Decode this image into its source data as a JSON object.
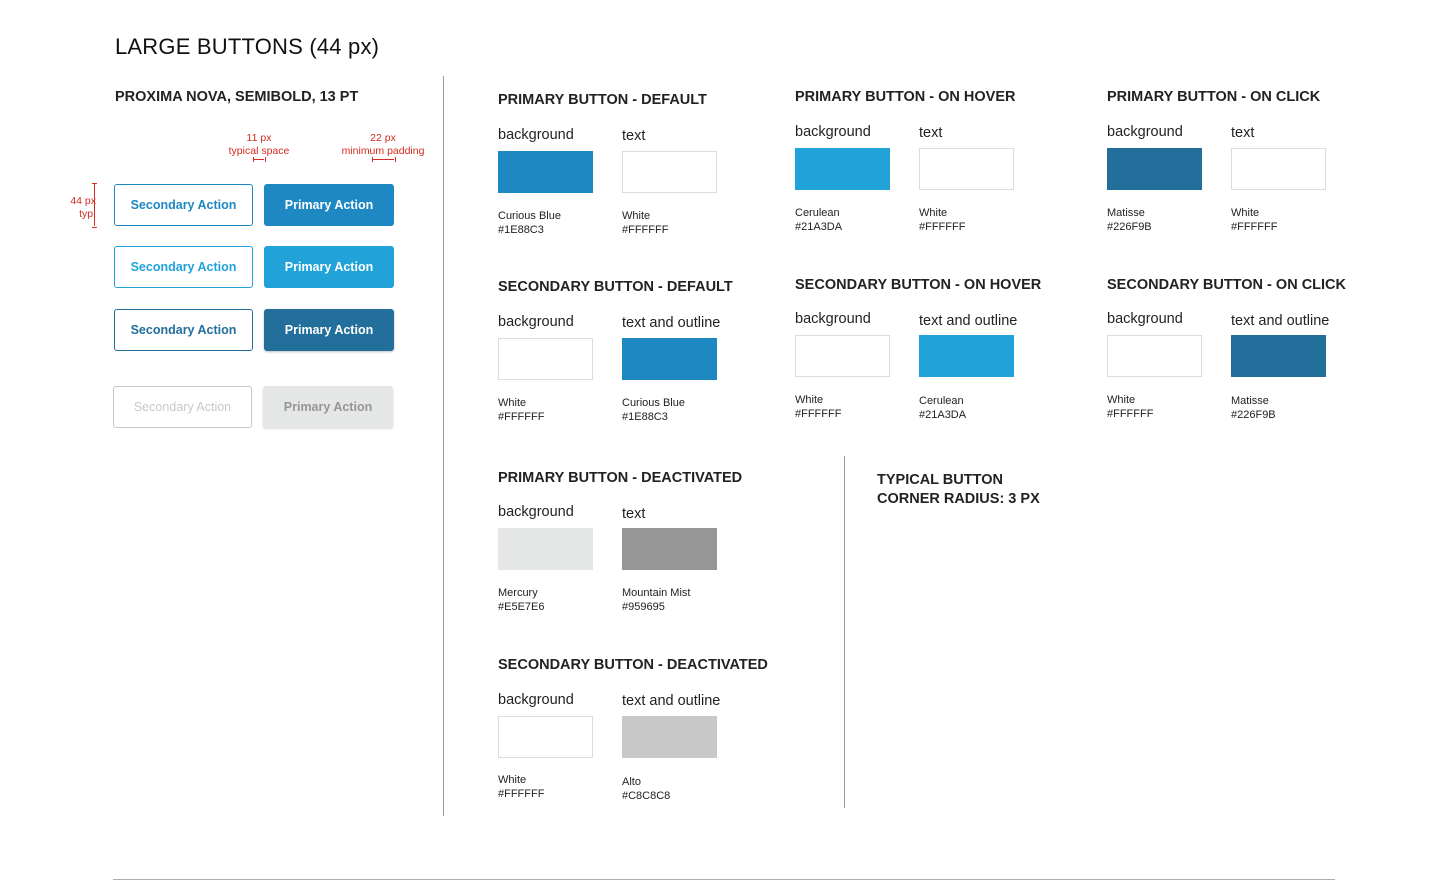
{
  "title": "LARGE BUTTONS (44 px)",
  "font_spec": "PROXIMA NOVA, SEMIBOLD, 13 PT",
  "annotations": {
    "typical_space_value": "11 px",
    "typical_space_label": "typical space",
    "min_padding_value": "22 px",
    "min_padding_label": "minimum padding",
    "height_value": "44 px",
    "height_label": "typ."
  },
  "buttons": {
    "secondary_label": "Secondary Action",
    "primary_label": "Primary Action"
  },
  "colors": {
    "curious_blue": "#1E88C3",
    "cerulean": "#21A3DA",
    "matisse": "#226F9B",
    "mercury": "#E5E7E6",
    "mountain_mist": "#959695",
    "alto": "#C8C8C8",
    "annotation_red": "#D42A20"
  },
  "sections": {
    "primary_default": {
      "title": "PRIMARY BUTTON - DEFAULT",
      "bg_label": "background",
      "bg_name": "Curious Blue",
      "bg_hex": "#1E88C3",
      "fg_label": "text",
      "fg_name": "White",
      "fg_hex": "#FFFFFF"
    },
    "primary_hover": {
      "title": "PRIMARY BUTTON - ON HOVER",
      "bg_label": "background",
      "bg_name": "Cerulean",
      "bg_hex": "#21A3DA",
      "fg_label": "text",
      "fg_name": "White",
      "fg_hex": "#FFFFFF"
    },
    "primary_click": {
      "title": "PRIMARY BUTTON - ON CLICK",
      "bg_label": "background",
      "bg_name": "Matisse",
      "bg_hex": "#226F9B",
      "fg_label": "text",
      "fg_name": "White",
      "fg_hex": "#FFFFFF"
    },
    "secondary_default": {
      "title": "SECONDARY BUTTON - DEFAULT",
      "bg_label": "background",
      "bg_name": "White",
      "bg_hex": "#FFFFFF",
      "fg_label": "text and outline",
      "fg_name": "Curious Blue",
      "fg_hex": "#1E88C3"
    },
    "secondary_hover": {
      "title": "SECONDARY BUTTON - ON HOVER",
      "bg_label": "background",
      "bg_name": "White",
      "bg_hex": "#FFFFFF",
      "fg_label": "text and outline",
      "fg_name": "Cerulean",
      "fg_hex": "#21A3DA"
    },
    "secondary_click": {
      "title": "SECONDARY BUTTON - ON CLICK",
      "bg_label": "background",
      "bg_name": "White",
      "bg_hex": "#FFFFFF",
      "fg_label": "text and outline",
      "fg_name": "Matisse",
      "fg_hex": "#226F9B"
    },
    "primary_deactivated": {
      "title": "PRIMARY BUTTON - DEACTIVATED",
      "bg_label": "background",
      "bg_name": "Mercury",
      "bg_hex": "#E5E7E6",
      "fg_label": "text",
      "fg_name": "Mountain Mist",
      "fg_hex": "#959695"
    },
    "secondary_deactivated": {
      "title": "SECONDARY BUTTON - DEACTIVATED",
      "bg_label": "background",
      "bg_name": "White",
      "bg_hex": "#FFFFFF",
      "fg_label": "text and outline",
      "fg_name": "Alto",
      "fg_hex": "#C8C8C8"
    }
  },
  "radius_note": {
    "line1": "TYPICAL BUTTON",
    "line2": "CORNER RADIUS:  3 PX"
  }
}
